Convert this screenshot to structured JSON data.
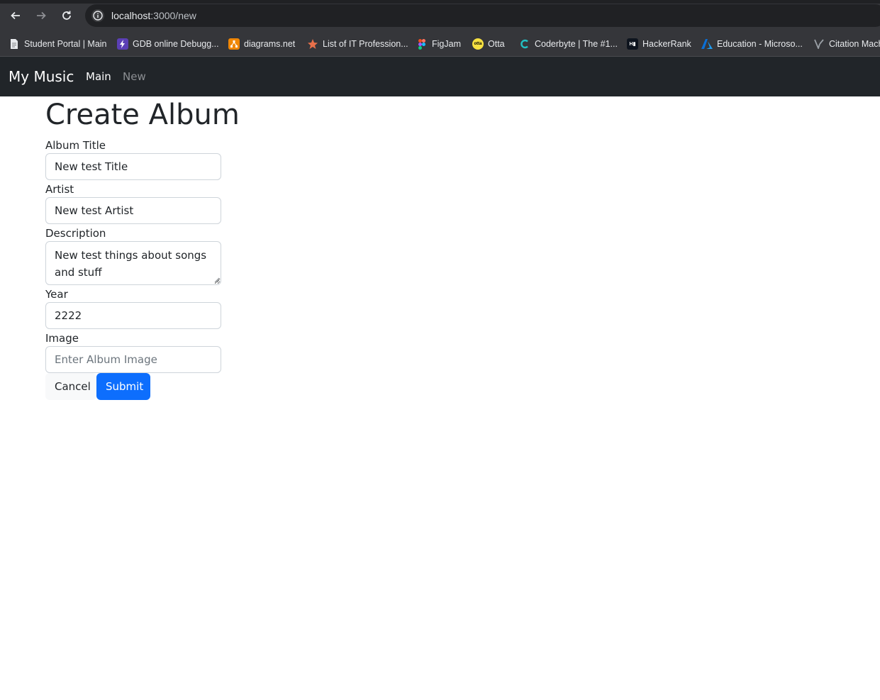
{
  "browser": {
    "url_host": "localhost",
    "url_path": ":3000/new",
    "bookmarks": [
      {
        "label": "Student Portal | Main",
        "icon": "document-icon"
      },
      {
        "label": "GDB online Debugg...",
        "icon": "gdb-icon"
      },
      {
        "label": "diagrams.net",
        "icon": "diagrams-icon"
      },
      {
        "label": "List of IT Profession...",
        "icon": "star-icon"
      },
      {
        "label": "FigJam",
        "icon": "figma-icon"
      },
      {
        "label": "Otta",
        "icon": "otta-icon"
      },
      {
        "label": "Coderbyte | The #1...",
        "icon": "coderbyte-icon"
      },
      {
        "label": "HackerRank",
        "icon": "hackerrank-icon"
      },
      {
        "label": "Education - Microso...",
        "icon": "azure-icon"
      },
      {
        "label": "Citation Mach",
        "icon": "citation-icon"
      }
    ]
  },
  "navbar": {
    "brand": "My Music",
    "links": [
      {
        "label": "Main",
        "active": true
      },
      {
        "label": "New",
        "active": false
      }
    ]
  },
  "form": {
    "title": "Create Album",
    "album_title": {
      "label": "Album Title",
      "value": "New test Title"
    },
    "artist": {
      "label": "Artist",
      "value": "New test Artist"
    },
    "description": {
      "label": "Description",
      "value": "New test things about songs and stuff"
    },
    "year": {
      "label": "Year",
      "value": "2222"
    },
    "image": {
      "label": "Image",
      "value": "",
      "placeholder": "Enter Album Image"
    },
    "cancel_label": "Cancel",
    "submit_label": "Submit"
  },
  "colors": {
    "navbar_bg": "#212529",
    "primary": "#0d6efd",
    "chrome_bg": "#35363a"
  }
}
